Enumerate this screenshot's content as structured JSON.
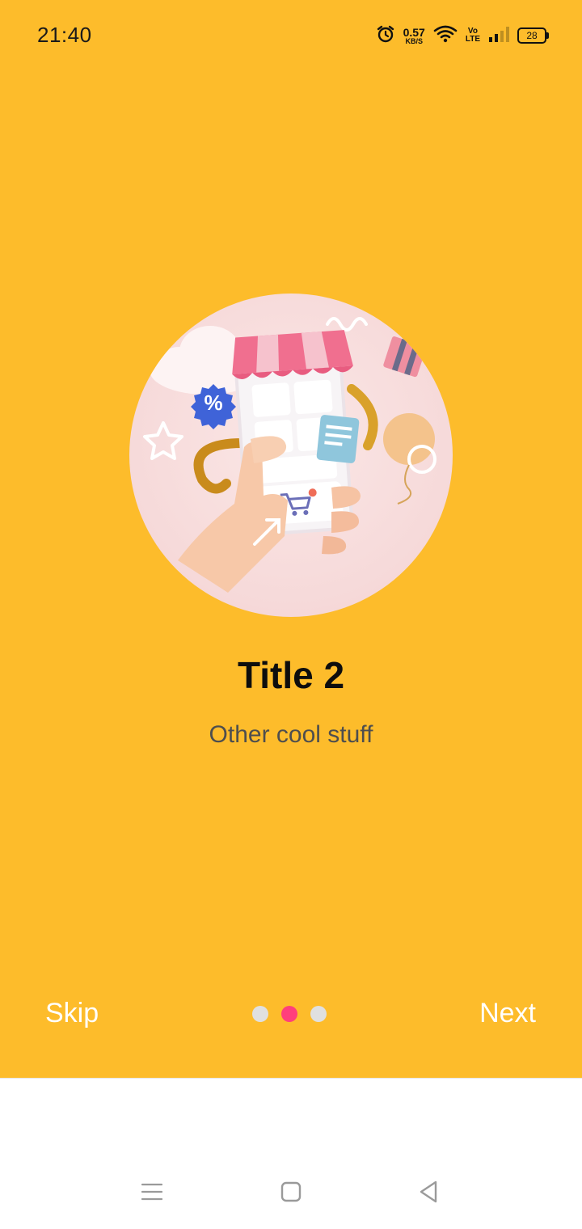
{
  "status_bar": {
    "time": "21:40",
    "net_speed_value": "0.57",
    "net_speed_unit": "KB/S",
    "volte_top": "Vo",
    "volte_bottom": "LTE",
    "battery": "28"
  },
  "slide": {
    "title": "Title 2",
    "subtitle": "Other cool stuff",
    "illustration_badge": "%"
  },
  "controls": {
    "skip_label": "Skip",
    "next_label": "Next",
    "page_count": 3,
    "active_page": 2
  },
  "colors": {
    "background": "#FDBC2B",
    "active_dot": "#FF3F7C",
    "inactive_dot": "#E0E0E0",
    "control_text": "#FFFFFF"
  },
  "nav_bar": {
    "icons": [
      "menu-icon",
      "home-icon",
      "back-icon"
    ]
  }
}
